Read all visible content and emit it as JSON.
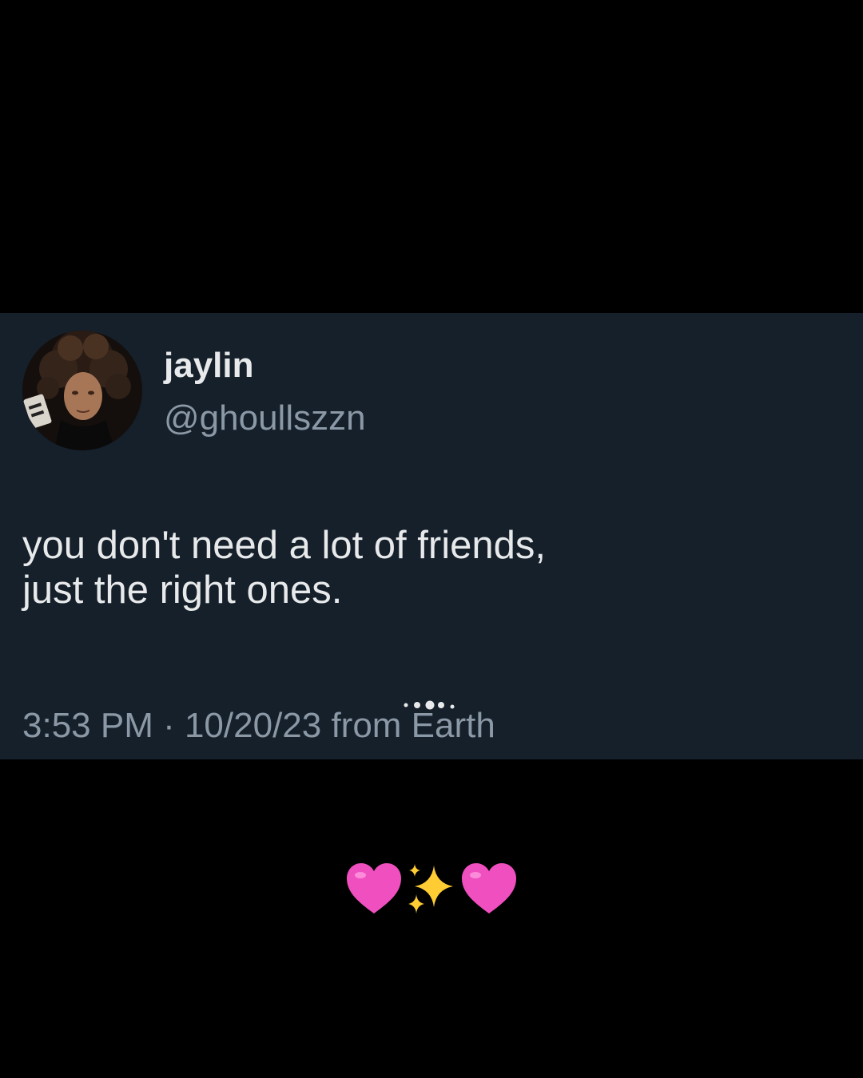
{
  "tweet": {
    "display_name": "jaylin",
    "handle": "@ghoullszzn",
    "text_line_1": "you don't need a lot of friends,",
    "text_line_2": "just the right ones.",
    "timestamp": "3:53 PM · 10/20/23 from Earth"
  },
  "caption": {
    "emojis": [
      "heart-pink-icon",
      "sparkles-icon",
      "heart-pink-icon"
    ]
  },
  "colors": {
    "page_background": "#000000",
    "card_background": "#15202b",
    "primary_text": "#e7e9ea",
    "secondary_text": "#8b98a5",
    "heart_pink": "#f04fbf",
    "sparkle_yellow": "#ffcc33"
  }
}
